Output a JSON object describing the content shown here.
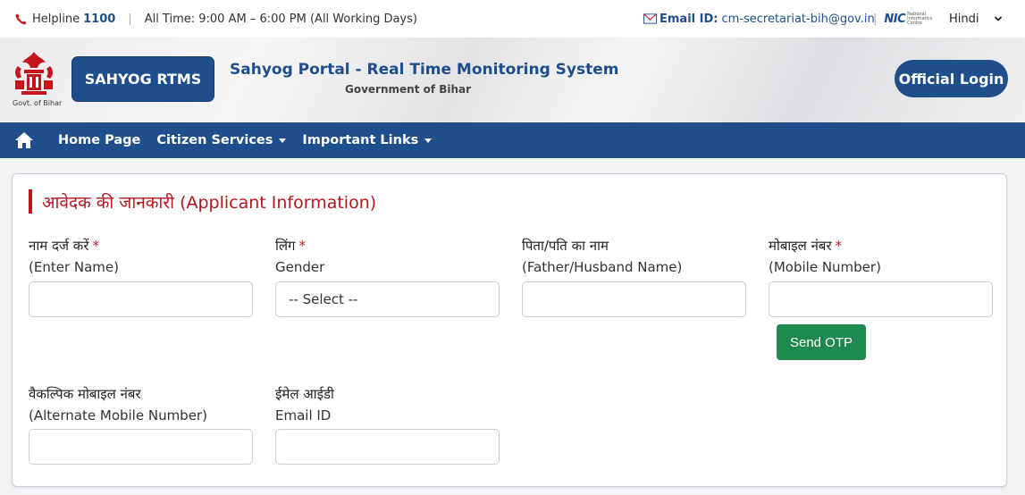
{
  "topbar": {
    "helpline_label": "Helpline",
    "helpline_number": "1100",
    "separator": "|",
    "timing": "All Time: 9:00 AM – 6:00 PM (All Working Days)",
    "email_label": "Email ID:",
    "email_value": "cm-secretariat-bih@gov.in",
    "nic_logo": "NIC",
    "nic_sub": "National Informatics Centre",
    "language": "Hindi"
  },
  "header": {
    "emblem_caption": "Govt. of Bihar",
    "rtms_button": "SAHYOG RTMS",
    "portal_title": "Sahyog Portal - Real Time Monitoring System",
    "portal_subtitle": "Government of Bihar",
    "login_button": "Official Login"
  },
  "nav": {
    "items": [
      {
        "label": "Home Page"
      },
      {
        "label": "Citizen Services"
      },
      {
        "label": "Important Links"
      }
    ]
  },
  "form": {
    "section_title": "आवेदक की जानकारी (Applicant Information)",
    "required_mark": "*",
    "fields": [
      {
        "hi": "नाम दर्ज करें",
        "en": "(Enter Name)",
        "value": "",
        "placeholder": ""
      },
      {
        "hi": "लिंग",
        "en": "Gender",
        "value": "-- Select --"
      },
      {
        "hi": "पिता/पति का नाम",
        "en": "(Father/Husband Name)",
        "value": "",
        "placeholder": ""
      },
      {
        "hi": "मोबाइल नंबर",
        "en": "(Mobile Number)",
        "value": "",
        "placeholder": ""
      },
      {
        "hi": "वैकल्पिक मोबाइल नंबर",
        "en": "(Alternate Mobile Number)",
        "value": "",
        "placeholder": ""
      },
      {
        "hi": "ईमेल आईडी",
        "en": "Email ID",
        "value": "",
        "placeholder": ""
      }
    ],
    "send_otp": "Send OTP"
  },
  "colors": {
    "primary_blue": "#1f4e8c",
    "accent_red": "#c0161c",
    "otp_green": "#1e8a4f"
  }
}
